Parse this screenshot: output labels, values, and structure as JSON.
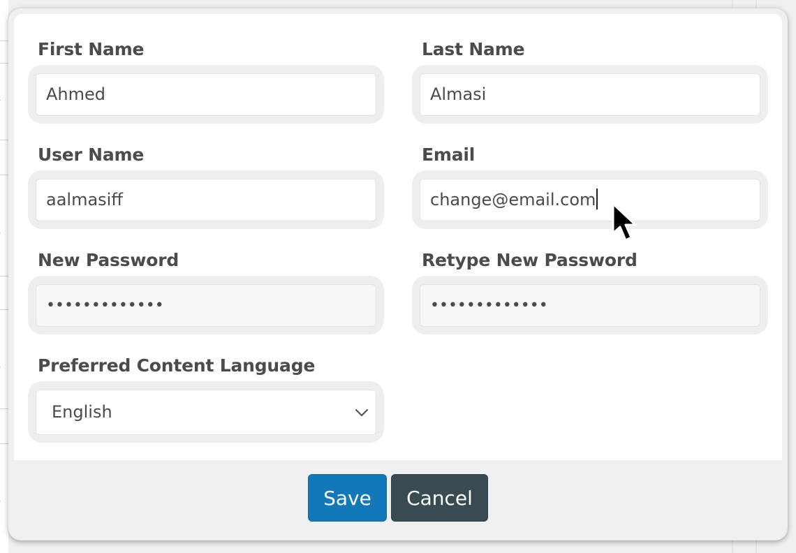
{
  "form": {
    "first_name": {
      "label": "First Name",
      "value": "Ahmed"
    },
    "last_name": {
      "label": "Last Name",
      "value": "Almasi"
    },
    "user_name": {
      "label": "User Name",
      "value": "aalmasiff"
    },
    "email": {
      "label": "Email",
      "value": "change@email.com"
    },
    "new_password": {
      "label": "New Password",
      "value": "•••••••••••••"
    },
    "retype_password": {
      "label": "Retype New Password",
      "value": "•••••••••••••"
    },
    "language": {
      "label": "Preferred Content Language",
      "value": "English"
    }
  },
  "footer": {
    "save_label": "Save",
    "cancel_label": "Cancel"
  },
  "colors": {
    "save_button": "#1378b9",
    "cancel_button": "#394a52",
    "label_text": "#4b4b4b"
  },
  "background": {
    "info_icon_glyph": "i"
  }
}
